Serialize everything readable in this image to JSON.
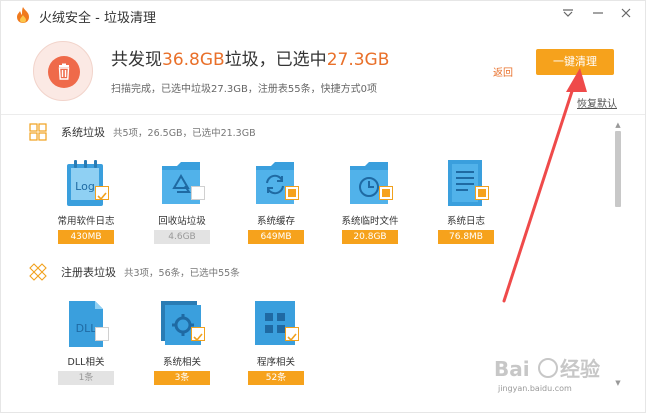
{
  "window": {
    "title": "火绒安全 - 垃圾清理",
    "menu_icon": "chevron-down-icon",
    "minimize_icon": "minimize-icon",
    "close_icon": "close-icon"
  },
  "header": {
    "prefix": "共发现",
    "found_size": "36.8GB",
    "mid": "垃圾，已选中",
    "selected_size": "27.3GB",
    "summary": "扫描完成，已选中垃圾27.3GB，注册表55条，快捷方式0项",
    "back_label": "返回",
    "clean_label": "一键清理",
    "restore_label": "恢复默认"
  },
  "sections": {
    "system": {
      "title": "系统垃圾",
      "stat": "共5项，26.5GB，已选中21.3GB",
      "items": [
        {
          "label": "常用软件日志",
          "size": "430MB",
          "icon": "log-file-icon",
          "state": "checked"
        },
        {
          "label": "回收站垃圾",
          "size": "4.6GB",
          "icon": "recycle-bin-icon",
          "state": "unchecked"
        },
        {
          "label": "系统缓存",
          "size": "649MB",
          "icon": "system-cache-icon",
          "state": "partial"
        },
        {
          "label": "系统临时文件",
          "size": "20.8GB",
          "icon": "temp-folder-icon",
          "state": "partial"
        },
        {
          "label": "系统日志",
          "size": "76.8MB",
          "icon": "system-log-icon",
          "state": "partial"
        }
      ]
    },
    "registry": {
      "title": "注册表垃圾",
      "stat": "共3项，56条，已选中55条",
      "items": [
        {
          "label": "DLL相关",
          "size": "1条",
          "icon": "dll-file-icon",
          "state": "unchecked"
        },
        {
          "label": "系统相关",
          "size": "3条",
          "icon": "system-settings-icon",
          "state": "checked"
        },
        {
          "label": "程序相关",
          "size": "52条",
          "icon": "program-apps-icon",
          "state": "checked"
        }
      ]
    }
  },
  "colors": {
    "accent": "#f6a21c",
    "highlight": "#e9702a",
    "icon_blue": "#3a9fdd",
    "annotation_red": "#ef4a4a"
  },
  "watermark": {
    "brand": "Baidu 经验",
    "url": "jingyan.baidu.com"
  }
}
